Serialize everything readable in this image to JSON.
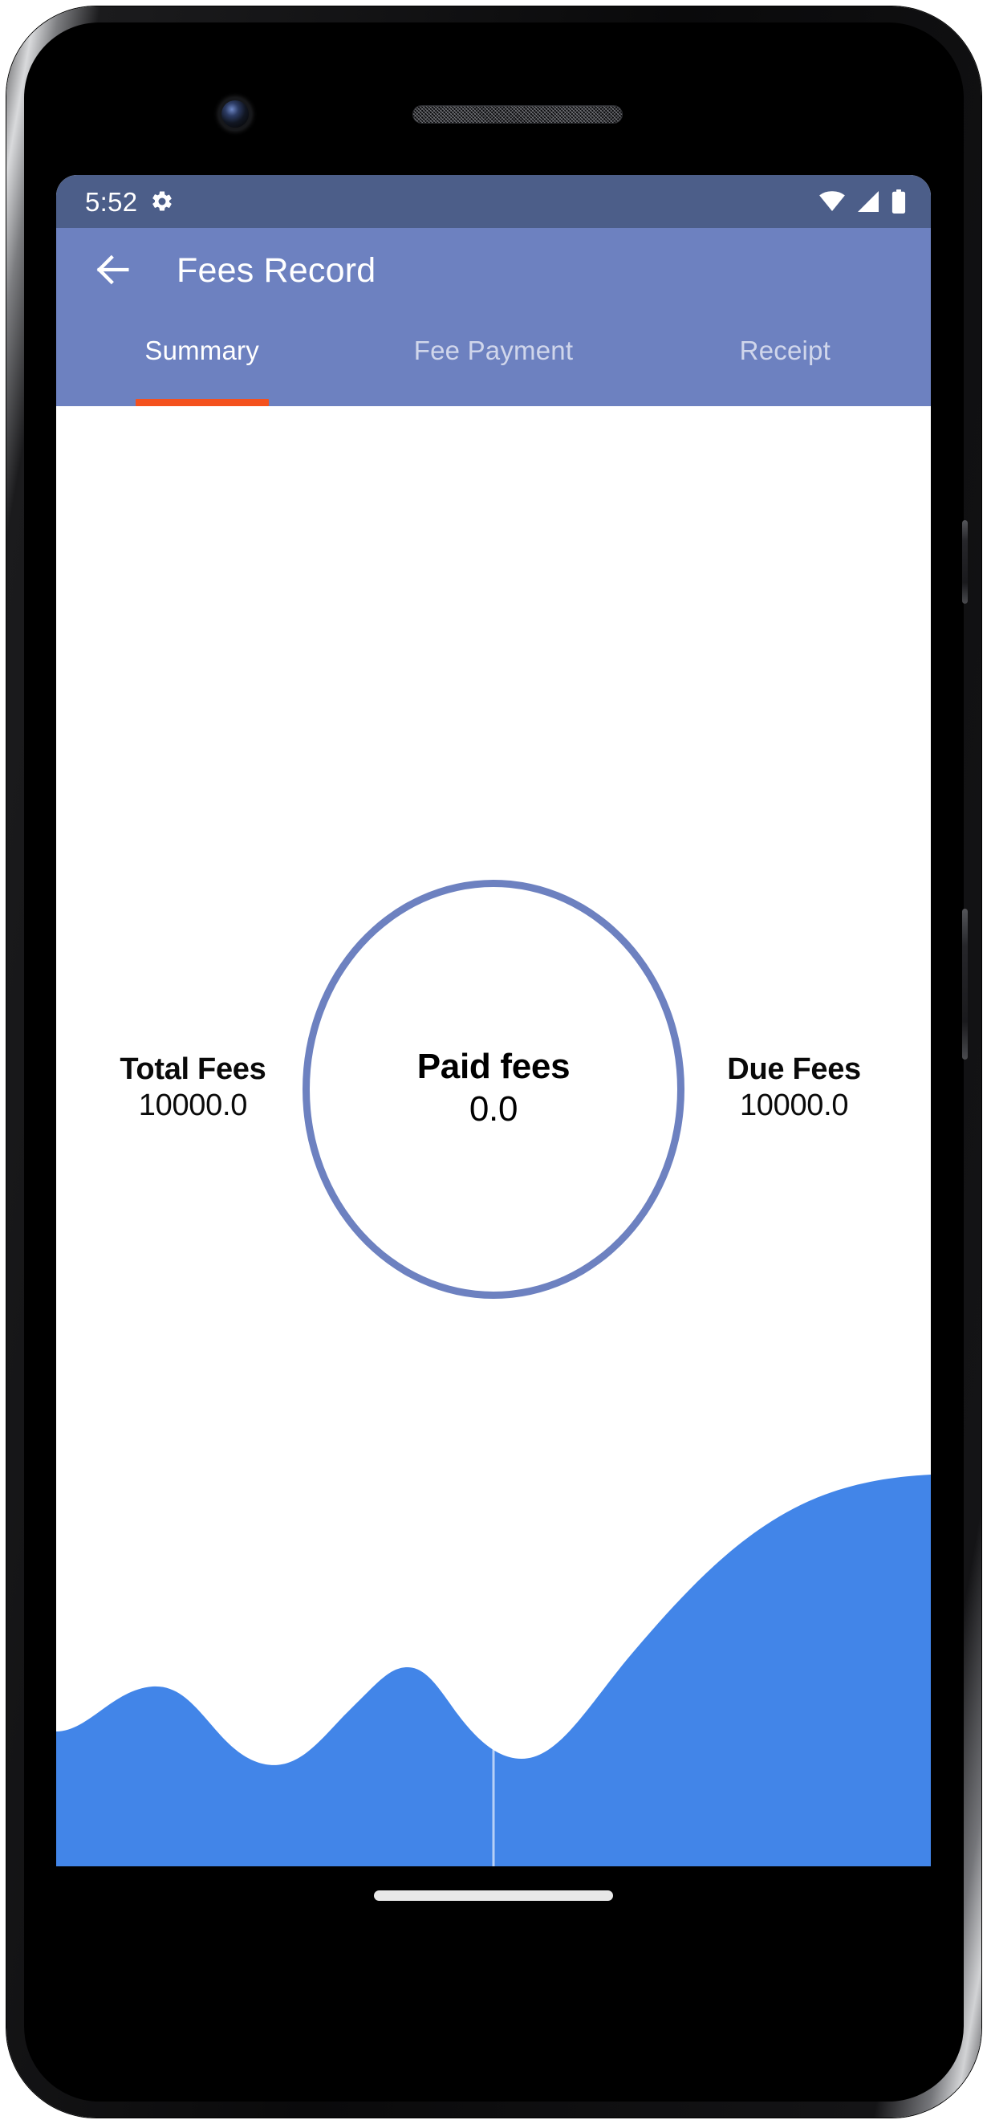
{
  "status_bar": {
    "time": "5:52",
    "icons": {
      "settings": "gear-icon",
      "wifi": "wifi-icon",
      "cellular": "cellular-signal-icon",
      "battery": "battery-full-icon"
    },
    "background_color": "#4c5e89"
  },
  "app_bar": {
    "back_icon": "arrow-left-icon",
    "title": "Fees Record",
    "background_color": "#6d81c0"
  },
  "tabs": {
    "active_index": 0,
    "indicator_color": "#f4511e",
    "items": [
      {
        "label": "Summary"
      },
      {
        "label": "Fee Payment"
      },
      {
        "label": "Receipt"
      }
    ]
  },
  "summary": {
    "total": {
      "label": "Total Fees",
      "value": "10000.0"
    },
    "paid": {
      "label": "Paid fees",
      "value": "0.0"
    },
    "due": {
      "label": "Due Fees",
      "value": "10000.0"
    },
    "circle_stroke_color": "#6d81c0",
    "wave_color": "#4285e8"
  },
  "system_nav": {
    "home_indicator": "home-indicator-pill"
  }
}
